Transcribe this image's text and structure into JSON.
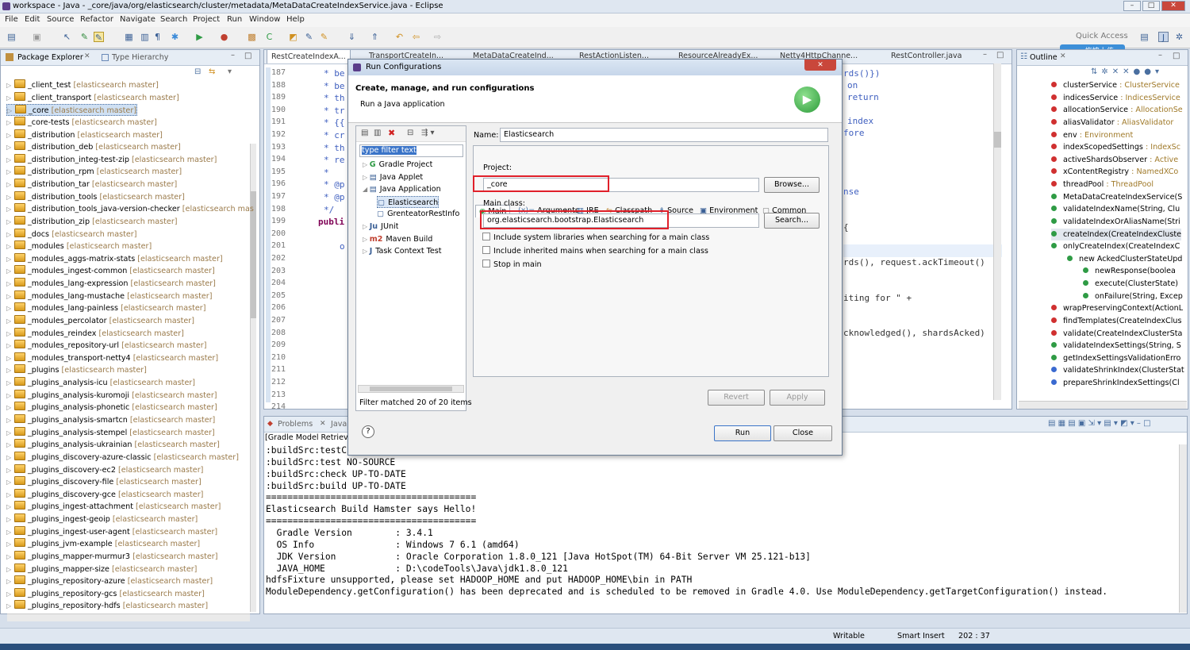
{
  "window": {
    "title": "workspace - Java - _core/java/org/elasticsearch/cluster/metadata/MetaDataCreateIndexService.java - Eclipse"
  },
  "menu": [
    "File",
    "Edit",
    "Source",
    "Refactor",
    "Navigate",
    "Search",
    "Project",
    "Run",
    "Window",
    "Help"
  ],
  "toolbar": {
    "quick_access": "Quick Access",
    "upload_label": "拖拽上传"
  },
  "package_explorer": {
    "tab_label": "Package Explorer",
    "hierarchy_tab": "Type Hierarchy",
    "items": [
      {
        "name": "_client_test",
        "branch": "[elasticsearch master]"
      },
      {
        "name": "_client_transport",
        "branch": "[elasticsearch master]"
      },
      {
        "name": "_core",
        "branch": "[elasticsearch master]"
      },
      {
        "name": "_core-tests",
        "branch": "[elasticsearch master]"
      },
      {
        "name": "_distribution",
        "branch": "[elasticsearch master]"
      },
      {
        "name": "_distribution_deb",
        "branch": "[elasticsearch master]"
      },
      {
        "name": "_distribution_integ-test-zip",
        "branch": "[elasticsearch master]"
      },
      {
        "name": "_distribution_rpm",
        "branch": "[elasticsearch master]"
      },
      {
        "name": "_distribution_tar",
        "branch": "[elasticsearch master]"
      },
      {
        "name": "_distribution_tools",
        "branch": "[elasticsearch master]"
      },
      {
        "name": "_distribution_tools_java-version-checker",
        "branch": "[elasticsearch mas"
      },
      {
        "name": "_distribution_zip",
        "branch": "[elasticsearch master]"
      },
      {
        "name": "_docs",
        "branch": "[elasticsearch master]"
      },
      {
        "name": "_modules",
        "branch": "[elasticsearch master]"
      },
      {
        "name": "_modules_aggs-matrix-stats",
        "branch": "[elasticsearch master]"
      },
      {
        "name": "_modules_ingest-common",
        "branch": "[elasticsearch master]"
      },
      {
        "name": "_modules_lang-expression",
        "branch": "[elasticsearch master]"
      },
      {
        "name": "_modules_lang-mustache",
        "branch": "[elasticsearch master]"
      },
      {
        "name": "_modules_lang-painless",
        "branch": "[elasticsearch master]"
      },
      {
        "name": "_modules_percolator",
        "branch": "[elasticsearch master]"
      },
      {
        "name": "_modules_reindex",
        "branch": "[elasticsearch master]"
      },
      {
        "name": "_modules_repository-url",
        "branch": "[elasticsearch master]"
      },
      {
        "name": "_modules_transport-netty4",
        "branch": "[elasticsearch master]"
      },
      {
        "name": "_plugins",
        "branch": "[elasticsearch master]"
      },
      {
        "name": "_plugins_analysis-icu",
        "branch": "[elasticsearch master]"
      },
      {
        "name": "_plugins_analysis-kuromoji",
        "branch": "[elasticsearch master]"
      },
      {
        "name": "_plugins_analysis-phonetic",
        "branch": "[elasticsearch master]"
      },
      {
        "name": "_plugins_analysis-smartcn",
        "branch": "[elasticsearch master]"
      },
      {
        "name": "_plugins_analysis-stempel",
        "branch": "[elasticsearch master]"
      },
      {
        "name": "_plugins_analysis-ukrainian",
        "branch": "[elasticsearch master]"
      },
      {
        "name": "_plugins_discovery-azure-classic",
        "branch": "[elasticsearch master]"
      },
      {
        "name": "_plugins_discovery-ec2",
        "branch": "[elasticsearch master]"
      },
      {
        "name": "_plugins_discovery-file",
        "branch": "[elasticsearch master]"
      },
      {
        "name": "_plugins_discovery-gce",
        "branch": "[elasticsearch master]"
      },
      {
        "name": "_plugins_ingest-attachment",
        "branch": "[elasticsearch master]"
      },
      {
        "name": "_plugins_ingest-geoip",
        "branch": "[elasticsearch master]"
      },
      {
        "name": "_plugins_ingest-user-agent",
        "branch": "[elasticsearch master]"
      },
      {
        "name": "_plugins_jvm-example",
        "branch": "[elasticsearch master]"
      },
      {
        "name": "_plugins_mapper-murmur3",
        "branch": "[elasticsearch master]"
      },
      {
        "name": "_plugins_mapper-size",
        "branch": "[elasticsearch master]"
      },
      {
        "name": "_plugins_repository-azure",
        "branch": "[elasticsearch master]"
      },
      {
        "name": "_plugins_repository-gcs",
        "branch": "[elasticsearch master]"
      },
      {
        "name": "_plugins_repository-hdfs",
        "branch": "[elasticsearch master]"
      }
    ]
  },
  "editor": {
    "tabs": [
      "RestCreateIndexA...",
      "TransportCreateIn...",
      "MetaDataCreateInd...",
      "RestActionListen...",
      "ResourceAlreadyEx...",
      "Netty4HttpChanne...",
      "RestController.java"
    ],
    "line_numbers": [
      "187",
      "188",
      "189",
      "190",
      "191",
      "192",
      "193",
      "194",
      "195",
      "196",
      "197",
      "198",
      "199",
      "200",
      "201",
      "202",
      "203",
      "204",
      "205",
      "206",
      "207",
      "208",
      "209",
      "210",
      "211",
      "212",
      "213",
      "214"
    ],
    "left_fragments": [
      "* be",
      "* be",
      "* th",
      "* tr",
      "* {{",
      "* cr",
      "* th",
      "* re",
      "*",
      "* @p",
      "* @p",
      "*/",
      "publi",
      "o"
    ],
    "right_fragments": [
      "rds()})",
      "on",
      "return",
      "index",
      "fore",
      "nse",
      "{",
      "rds(), request.ackTimeout()",
      "iting for \" +",
      "cknowledged(), shardsAcked)"
    ]
  },
  "bottom": {
    "problems_tab": "Problems",
    "java_tab": "Java",
    "gradle_label": "[Gradle Model Retrieva",
    "console": [
      ":buildSrc:testC",
      ":buildSrc:test NO-SOURCE",
      ":buildSrc:check UP-TO-DATE",
      ":buildSrc:build UP-TO-DATE",
      "=======================================",
      "Elasticsearch Build Hamster says Hello!",
      "=======================================",
      "  Gradle Version        : 3.4.1",
      "  OS Info               : Windows 7 6.1 (amd64)",
      "  JDK Version           : Oracle Corporation 1.8.0_121 [Java HotSpot(TM) 64-Bit Server VM 25.121-b13]",
      "  JAVA_HOME             : D:\\codeTools\\Java\\jdk1.8.0_121",
      "hdfsFixture unsupported, please set HADOOP_HOME and put HADOOP_HOME\\bin in PATH",
      "ModuleDependency.getConfiguration() has been deprecated and is scheduled to be removed in Gradle 4.0. Use ModuleDependency.getTargetConfiguration() instead."
    ]
  },
  "outline": {
    "tab_label": "Outline",
    "items": [
      {
        "name": "clusterService",
        "type": " : ClusterService",
        "color": "#d03030"
      },
      {
        "name": "indicesService",
        "type": " : IndicesService",
        "color": "#d03030"
      },
      {
        "name": "allocationService",
        "type": " : AllocationSe",
        "color": "#d03030"
      },
      {
        "name": "aliasValidator",
        "type": " : AliasValidator",
        "color": "#d03030"
      },
      {
        "name": "env",
        "type": " : Environment",
        "color": "#d03030"
      },
      {
        "name": "indexScopedSettings",
        "type": " : IndexSc",
        "color": "#d03030"
      },
      {
        "name": "activeShardsObserver",
        "type": " : Active",
        "color": "#d03030"
      },
      {
        "name": "xContentRegistry",
        "type": " : NamedXCo",
        "color": "#d03030"
      },
      {
        "name": "threadPool",
        "type": " : ThreadPool",
        "color": "#d03030"
      },
      {
        "name": "MetaDataCreateIndexService(S",
        "type": "",
        "color": "#2f9b45"
      },
      {
        "name": "validateIndexName(String, Clu",
        "type": "",
        "color": "#2f9b45"
      },
      {
        "name": "validateIndexOrAliasName(Stri",
        "type": "",
        "color": "#2f9b45"
      },
      {
        "name": "createIndex(CreateIndexCluste",
        "type": "",
        "color": "#2f9b45"
      },
      {
        "name": "onlyCreateIndex(CreateIndexC",
        "type": "",
        "color": "#2f9b45"
      },
      {
        "name": "new AckedClusterStateUpd",
        "type": "",
        "color": "#2f9b45"
      },
      {
        "name": "newResponse(boolea",
        "type": "",
        "color": "#2f9b45"
      },
      {
        "name": "execute(ClusterState)",
        "type": "",
        "color": "#2f9b45"
      },
      {
        "name": "onFailure(String, Excep",
        "type": "",
        "color": "#2f9b45"
      },
      {
        "name": "wrapPreservingContext(ActionL",
        "type": "",
        "color": "#d03030"
      },
      {
        "name": "findTemplates(CreateIndexClus",
        "type": "",
        "color": "#d03030"
      },
      {
        "name": "validate(CreateIndexClusterSta",
        "type": "",
        "color": "#d03030"
      },
      {
        "name": "validateIndexSettings(String, S",
        "type": "",
        "color": "#2f9b45"
      },
      {
        "name": "getIndexSettingsValidationErro",
        "type": "",
        "color": "#2f9b45"
      },
      {
        "name": "validateShrinkIndex(ClusterStat",
        "type": "",
        "color": "#3a6ad0"
      },
      {
        "name": "prepareShrinkIndexSettings(Cl",
        "type": "",
        "color": "#3a6ad0"
      }
    ]
  },
  "dialog": {
    "title": "Run Configurations",
    "heading": "Create, manage, and run configurations",
    "subheading": "Run a Java application",
    "filter_placeholder": "type filter text",
    "tree": [
      {
        "label": "Gradle Project",
        "indent": 0
      },
      {
        "label": "Java Applet",
        "indent": 0
      },
      {
        "label": "Java Application",
        "indent": 0
      },
      {
        "label": "Elasticsearch",
        "indent": 1
      },
      {
        "label": "GrenteatorRestInfo",
        "indent": 1
      },
      {
        "label": "JUnit",
        "indent": 0
      },
      {
        "label": "Maven Build",
        "indent": 0
      },
      {
        "label": "Task Context Test",
        "indent": 0
      }
    ],
    "filter_status": "Filter matched 20 of 20 items",
    "name_label": "Name:",
    "name_value": "Elasticsearch",
    "tabs": [
      "Main",
      "Arguments",
      "JRE",
      "Classpath",
      "Source",
      "Environment",
      "Common"
    ],
    "project_label": "Project:",
    "project_value": "_core",
    "browse_button": "Browse...",
    "main_class_label": "Main class:",
    "main_class_value": "org.elasticsearch.bootstrap.Elasticsearch",
    "search_button": "Search...",
    "checkboxes": [
      "Include system libraries when searching for a main class",
      "Include inherited mains when searching for a main class",
      "Stop in main"
    ],
    "revert_button": "Revert",
    "apply_button": "Apply",
    "run_button": "Run",
    "close_button": "Close",
    "help_icon": "?"
  },
  "status": {
    "writable": "Writable",
    "insert": "Smart Insert",
    "position": "202 : 37"
  }
}
